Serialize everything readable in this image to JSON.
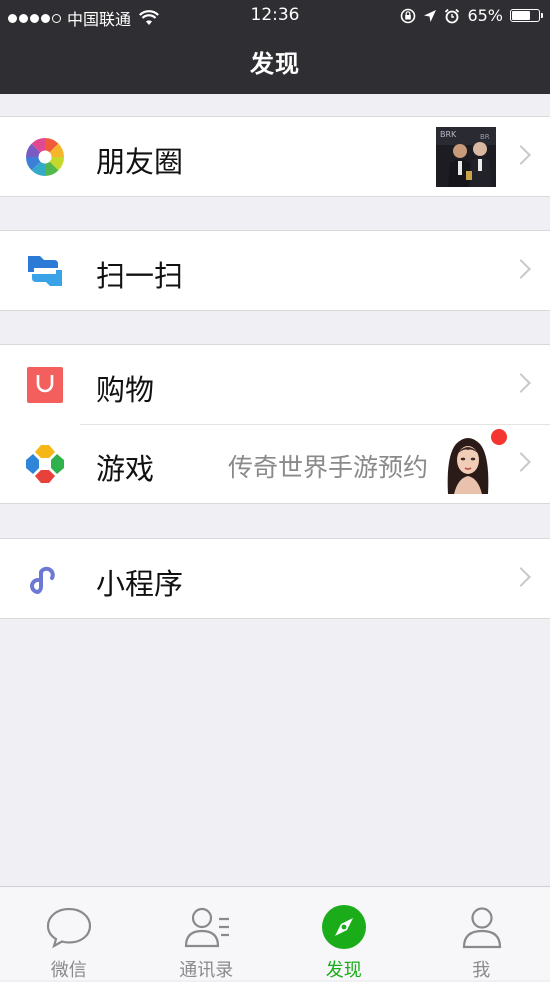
{
  "status_bar": {
    "carrier": "中国联通",
    "time": "12:36",
    "battery": "65%"
  },
  "nav": {
    "title": "发现"
  },
  "menu": [
    {
      "label": "朋友圈",
      "icon": "moments-aperture-icon"
    },
    {
      "label": "扫一扫",
      "icon": "scan-icon"
    },
    {
      "label": "购物",
      "icon": "shopping-bag-icon"
    },
    {
      "label": "游戏",
      "icon": "games-icon",
      "promo_text": "传奇世界手游预约"
    },
    {
      "label": "小程序",
      "icon": "mini-program-icon"
    }
  ],
  "tabs": [
    {
      "label": "微信",
      "icon": "chat-bubble-icon"
    },
    {
      "label": "通讯录",
      "icon": "contacts-icon"
    },
    {
      "label": "发现",
      "icon": "compass-icon",
      "active": true
    },
    {
      "label": "我",
      "icon": "person-icon"
    }
  ],
  "colors": {
    "header_bg": "#2f2f33",
    "page_bg": "#efeff4",
    "active_green": "#1aad19",
    "badge_red": "#f43530"
  }
}
